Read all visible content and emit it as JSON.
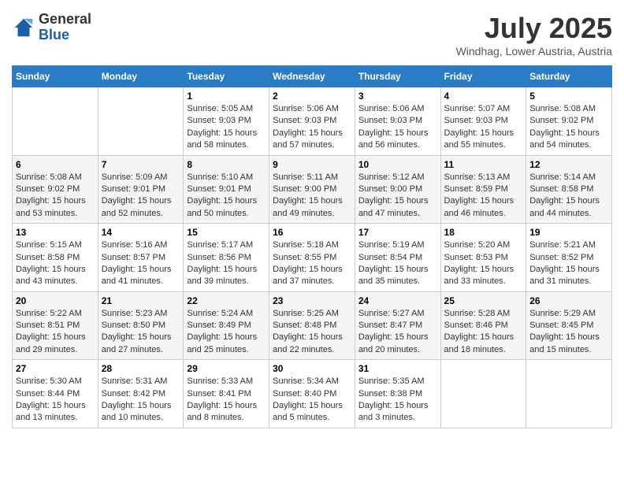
{
  "header": {
    "logo_general": "General",
    "logo_blue": "Blue",
    "month_title": "July 2025",
    "location": "Windhag, Lower Austria, Austria"
  },
  "calendar": {
    "days_of_week": [
      "Sunday",
      "Monday",
      "Tuesday",
      "Wednesday",
      "Thursday",
      "Friday",
      "Saturday"
    ],
    "weeks": [
      [
        {
          "day": "",
          "info": ""
        },
        {
          "day": "",
          "info": ""
        },
        {
          "day": "1",
          "info": "Sunrise: 5:05 AM\nSunset: 9:03 PM\nDaylight: 15 hours\nand 58 minutes."
        },
        {
          "day": "2",
          "info": "Sunrise: 5:06 AM\nSunset: 9:03 PM\nDaylight: 15 hours\nand 57 minutes."
        },
        {
          "day": "3",
          "info": "Sunrise: 5:06 AM\nSunset: 9:03 PM\nDaylight: 15 hours\nand 56 minutes."
        },
        {
          "day": "4",
          "info": "Sunrise: 5:07 AM\nSunset: 9:03 PM\nDaylight: 15 hours\nand 55 minutes."
        },
        {
          "day": "5",
          "info": "Sunrise: 5:08 AM\nSunset: 9:02 PM\nDaylight: 15 hours\nand 54 minutes."
        }
      ],
      [
        {
          "day": "6",
          "info": "Sunrise: 5:08 AM\nSunset: 9:02 PM\nDaylight: 15 hours\nand 53 minutes."
        },
        {
          "day": "7",
          "info": "Sunrise: 5:09 AM\nSunset: 9:01 PM\nDaylight: 15 hours\nand 52 minutes."
        },
        {
          "day": "8",
          "info": "Sunrise: 5:10 AM\nSunset: 9:01 PM\nDaylight: 15 hours\nand 50 minutes."
        },
        {
          "day": "9",
          "info": "Sunrise: 5:11 AM\nSunset: 9:00 PM\nDaylight: 15 hours\nand 49 minutes."
        },
        {
          "day": "10",
          "info": "Sunrise: 5:12 AM\nSunset: 9:00 PM\nDaylight: 15 hours\nand 47 minutes."
        },
        {
          "day": "11",
          "info": "Sunrise: 5:13 AM\nSunset: 8:59 PM\nDaylight: 15 hours\nand 46 minutes."
        },
        {
          "day": "12",
          "info": "Sunrise: 5:14 AM\nSunset: 8:58 PM\nDaylight: 15 hours\nand 44 minutes."
        }
      ],
      [
        {
          "day": "13",
          "info": "Sunrise: 5:15 AM\nSunset: 8:58 PM\nDaylight: 15 hours\nand 43 minutes."
        },
        {
          "day": "14",
          "info": "Sunrise: 5:16 AM\nSunset: 8:57 PM\nDaylight: 15 hours\nand 41 minutes."
        },
        {
          "day": "15",
          "info": "Sunrise: 5:17 AM\nSunset: 8:56 PM\nDaylight: 15 hours\nand 39 minutes."
        },
        {
          "day": "16",
          "info": "Sunrise: 5:18 AM\nSunset: 8:55 PM\nDaylight: 15 hours\nand 37 minutes."
        },
        {
          "day": "17",
          "info": "Sunrise: 5:19 AM\nSunset: 8:54 PM\nDaylight: 15 hours\nand 35 minutes."
        },
        {
          "day": "18",
          "info": "Sunrise: 5:20 AM\nSunset: 8:53 PM\nDaylight: 15 hours\nand 33 minutes."
        },
        {
          "day": "19",
          "info": "Sunrise: 5:21 AM\nSunset: 8:52 PM\nDaylight: 15 hours\nand 31 minutes."
        }
      ],
      [
        {
          "day": "20",
          "info": "Sunrise: 5:22 AM\nSunset: 8:51 PM\nDaylight: 15 hours\nand 29 minutes."
        },
        {
          "day": "21",
          "info": "Sunrise: 5:23 AM\nSunset: 8:50 PM\nDaylight: 15 hours\nand 27 minutes."
        },
        {
          "day": "22",
          "info": "Sunrise: 5:24 AM\nSunset: 8:49 PM\nDaylight: 15 hours\nand 25 minutes."
        },
        {
          "day": "23",
          "info": "Sunrise: 5:25 AM\nSunset: 8:48 PM\nDaylight: 15 hours\nand 22 minutes."
        },
        {
          "day": "24",
          "info": "Sunrise: 5:27 AM\nSunset: 8:47 PM\nDaylight: 15 hours\nand 20 minutes."
        },
        {
          "day": "25",
          "info": "Sunrise: 5:28 AM\nSunset: 8:46 PM\nDaylight: 15 hours\nand 18 minutes."
        },
        {
          "day": "26",
          "info": "Sunrise: 5:29 AM\nSunset: 8:45 PM\nDaylight: 15 hours\nand 15 minutes."
        }
      ],
      [
        {
          "day": "27",
          "info": "Sunrise: 5:30 AM\nSunset: 8:44 PM\nDaylight: 15 hours\nand 13 minutes."
        },
        {
          "day": "28",
          "info": "Sunrise: 5:31 AM\nSunset: 8:42 PM\nDaylight: 15 hours\nand 10 minutes."
        },
        {
          "day": "29",
          "info": "Sunrise: 5:33 AM\nSunset: 8:41 PM\nDaylight: 15 hours\nand 8 minutes."
        },
        {
          "day": "30",
          "info": "Sunrise: 5:34 AM\nSunset: 8:40 PM\nDaylight: 15 hours\nand 5 minutes."
        },
        {
          "day": "31",
          "info": "Sunrise: 5:35 AM\nSunset: 8:38 PM\nDaylight: 15 hours\nand 3 minutes."
        },
        {
          "day": "",
          "info": ""
        },
        {
          "day": "",
          "info": ""
        }
      ]
    ]
  }
}
